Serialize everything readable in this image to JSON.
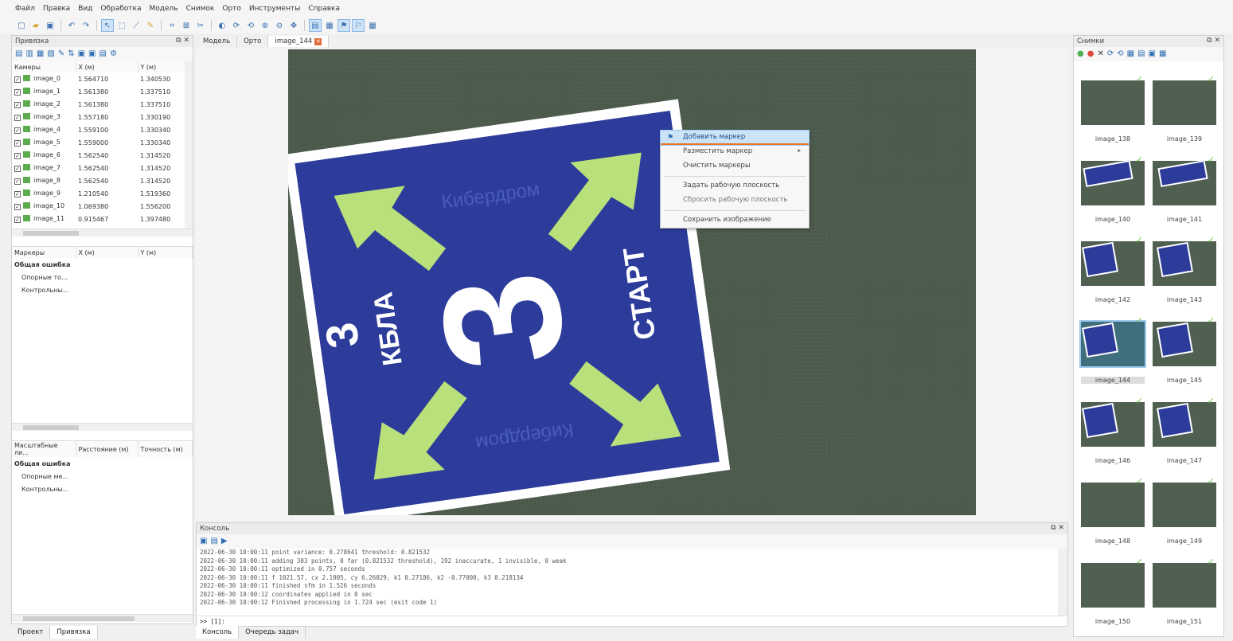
{
  "menu": [
    "Файл",
    "Правка",
    "Вид",
    "Обработка",
    "Модель",
    "Снимок",
    "Орто",
    "Инструменты",
    "Справка"
  ],
  "reference_panel": {
    "title": "Привязка",
    "cameras_header": [
      "Камеры",
      "X (м)",
      "Y (м)"
    ],
    "cameras": [
      {
        "name": "image_0",
        "x": "1.564710",
        "y": "1.340530"
      },
      {
        "name": "image_1",
        "x": "1.561380",
        "y": "1.337510"
      },
      {
        "name": "image_2",
        "x": "1.561380",
        "y": "1.337510"
      },
      {
        "name": "image_3",
        "x": "1.557180",
        "y": "1.330190"
      },
      {
        "name": "image_4",
        "x": "1.559100",
        "y": "1.330340"
      },
      {
        "name": "image_5",
        "x": "1.559000",
        "y": "1.330340"
      },
      {
        "name": "image_6",
        "x": "1.562540",
        "y": "1.314520"
      },
      {
        "name": "image_7",
        "x": "1.562540",
        "y": "1.314520"
      },
      {
        "name": "image_8",
        "x": "1.562540",
        "y": "1.314520"
      },
      {
        "name": "image_9",
        "x": "1.210540",
        "y": "1.519360"
      },
      {
        "name": "image_10",
        "x": "1.069380",
        "y": "1.556200"
      },
      {
        "name": "image_11",
        "x": "0.915467",
        "y": "1.397480"
      }
    ],
    "markers_header": [
      "Маркеры",
      "X (м)",
      "Y (м)"
    ],
    "markers_total": "Общая ошибка",
    "markers_items": [
      "Опорные то...",
      "Контрольны..."
    ],
    "scalebars_header": [
      "Масштабные ли...",
      "Расстояние (м)",
      "Точность (м)"
    ],
    "scalebars_total": "Общая ошибка",
    "scalebars_items": [
      "Опорные ме...",
      "Контрольны..."
    ],
    "bottom_tabs": [
      "Проект",
      "Привязка"
    ]
  },
  "view_tabs": {
    "model": "Модель",
    "ortho": "Орто",
    "image": "image_144"
  },
  "image_sign": {
    "text_top": "Кибердром",
    "text_left_num": "3",
    "text_left": "КБЛА",
    "text_center": "3",
    "text_right": "СТАРТ",
    "text_bottom": "Кибердром"
  },
  "context_menu": {
    "items": [
      "Добавить маркер",
      "Разместить маркер",
      "Очистить маркеры",
      "Задать рабочую плоскость",
      "Сбросить рабочую плоскость",
      "Сохранить изображение"
    ]
  },
  "console": {
    "title": "Консоль",
    "lines": [
      "2022-06-30 10:00:11 point variance: 0.278641 threshold: 0.821532",
      "2022-06-30 10:00:11 adding 303 points, 0 far (0.821532 threshold), 192 inaccurate, 1 invisible, 0 weak",
      "2022-06-30 10:00:11 optimized in 0.757 seconds",
      "2022-06-30 10:00:11 f 1021.57, cx 2.1005, cy 6.26029, k1 0.27186, k2 -0.77000, k3 0.218134",
      "2022-06-30 10:00:11 finished sfm in 1.526 seconds",
      "2022-06-30 10:00:12 coordinates applied in 0 sec",
      "2022-06-30 10:00:12 Finished processing in 1.724 sec (exit code 1)"
    ],
    "prompt": ">> [1]:",
    "bottom_tabs": [
      "Консоль",
      "Очередь задач"
    ]
  },
  "photos": {
    "title": "Снимки",
    "items": [
      "image_138",
      "image_139",
      "image_140",
      "image_141",
      "image_142",
      "image_143",
      "image_144",
      "image_145",
      "image_146",
      "image_147",
      "image_148",
      "image_149",
      "image_150",
      "image_151"
    ]
  },
  "colors": {
    "accent": "#e8762a",
    "selection": "#cbe4f9",
    "sign_blue": "#2d3c9a",
    "arrow_green": "#b9e07a",
    "check_green": "#6cc24a"
  }
}
